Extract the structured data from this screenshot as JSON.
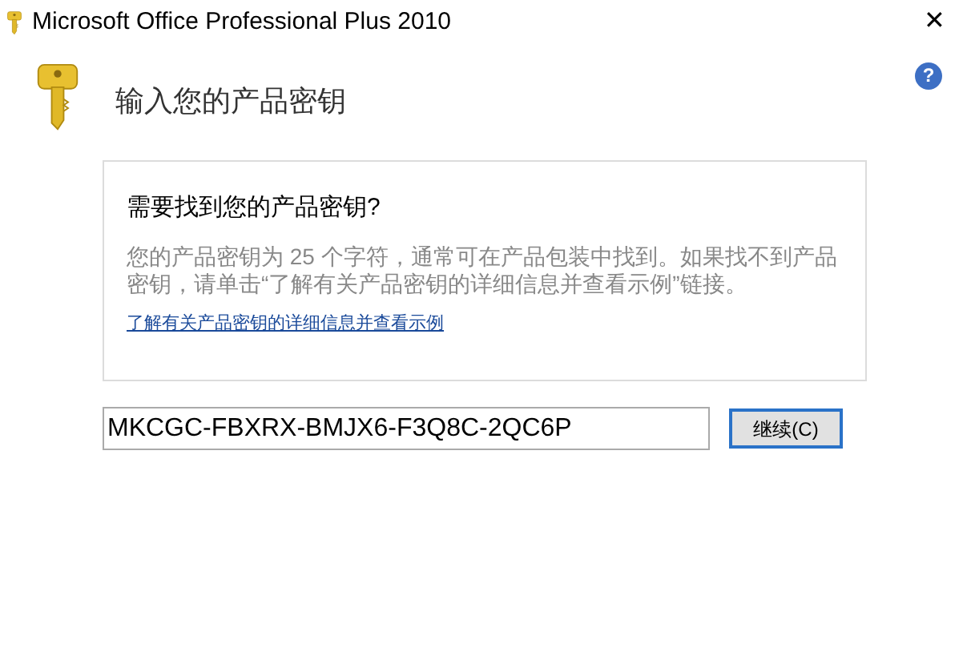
{
  "window": {
    "title": "Microsoft Office Professional Plus 2010",
    "close": "✕"
  },
  "heading": "输入您的产品密钥",
  "help": "?",
  "info": {
    "title": "需要找到您的产品密钥?",
    "body": "您的产品密钥为 25 个字符，通常可在产品包装中找到。如果找不到产品密钥，请单击“了解有关产品密钥的详细信息并查看示例”链接。",
    "link": "了解有关产品密钥的详细信息并查看示例"
  },
  "key_field": {
    "value": "MKCGC-FBXRX-BMJX6-F3Q8C-2QC6P"
  },
  "continue_button": {
    "label": "继续(C)"
  }
}
